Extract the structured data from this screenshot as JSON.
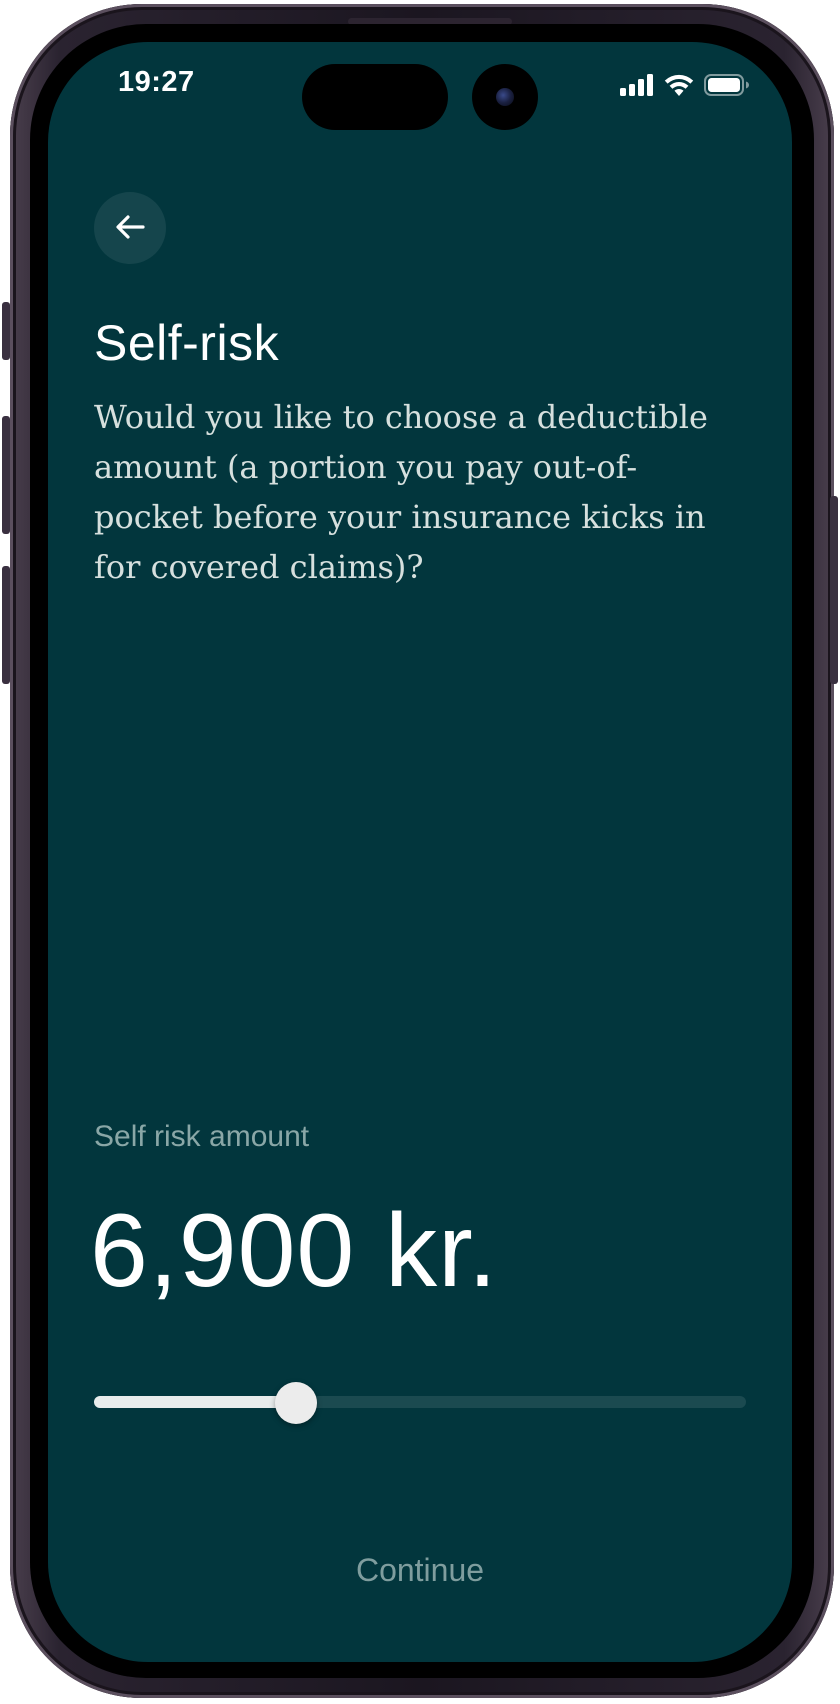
{
  "status_bar": {
    "time": "19:27",
    "icons": [
      "cellular-signal-icon",
      "wifi-icon",
      "battery-icon"
    ]
  },
  "header": {
    "back_icon": "arrow-left-icon",
    "title": "Self-risk",
    "description": "Would you like to choose a deductible amount (a portion you pay out-of-pocket before your insurance kicks in for covered claims)?"
  },
  "amount": {
    "label": "Self risk amount",
    "value": "6,900 kr.",
    "slider_fraction": 0.31
  },
  "footer": {
    "continue_label": "Continue"
  },
  "colors": {
    "background": "#02363d",
    "text_primary": "#ffffff",
    "text_muted": "#8aa7a7",
    "slider_track": "#1b4a50",
    "slider_fill": "#e8ecec"
  }
}
